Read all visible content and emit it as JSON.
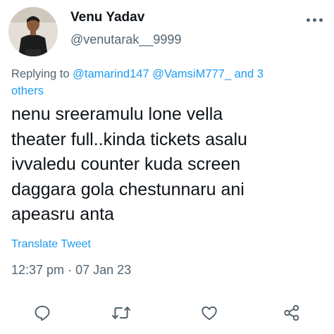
{
  "tweet": {
    "display_name": "Venu Yadav",
    "handle": "@venutarak__9999",
    "reply": {
      "prefix": "Replying to ",
      "mention_1": "@tamarind147",
      "mention_2": "@VamsiM777_",
      "connector": " and ",
      "others_count": "3",
      "others_label": "others"
    },
    "body_lines": [
      "nenu sreeramulu lone vella",
      "theater full..kinda tickets asalu",
      "ivvaledu counter kuda screen",
      "daggara gola chestunnaru ani",
      "apeasru anta"
    ],
    "translate_label": "Translate Tweet",
    "time": "12:37 pm",
    "separator": " · ",
    "date": "07 Jan 23"
  },
  "actions": [
    {
      "icon": "reply-icon"
    },
    {
      "icon": "retweet-icon"
    },
    {
      "icon": "like-icon"
    },
    {
      "icon": "share-icon"
    }
  ],
  "colors": {
    "link": "#1d9bf0",
    "muted": "#536471",
    "text": "#0f1419"
  }
}
